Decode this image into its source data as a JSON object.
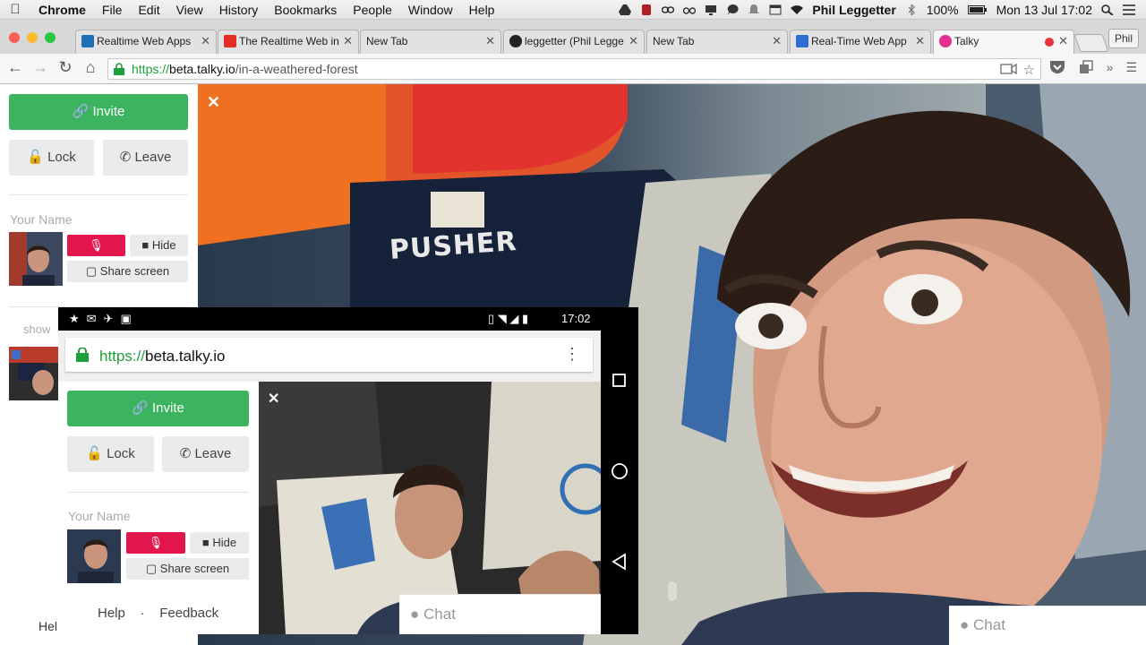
{
  "menubar": {
    "app": "Chrome",
    "items": [
      "File",
      "Edit",
      "View",
      "History",
      "Bookmarks",
      "People",
      "Window",
      "Help"
    ],
    "user": "Phil Leggetter",
    "battery": "100%",
    "datetime": "Mon 13 Jul  17:02"
  },
  "tabs": [
    {
      "title": "Realtime Web Apps",
      "favicon_color": "#1f6fb5"
    },
    {
      "title": "The Realtime Web in",
      "favicon_color": "#e52d27"
    },
    {
      "title": "New Tab",
      "favicon_color": ""
    },
    {
      "title": "leggetter (Phil Legge",
      "favicon_color": "#222222"
    },
    {
      "title": "New Tab",
      "favicon_color": ""
    },
    {
      "title": "Real-Time Web App",
      "favicon_color": "#2a6fd1"
    },
    {
      "title": "Talky",
      "favicon_color": "#e62f8e"
    }
  ],
  "profile_button": "Phil",
  "address": {
    "scheme": "https://",
    "host": "beta.talky.io",
    "path": "/in-a-weathered-forest"
  },
  "sidebar": {
    "invite": "Invite",
    "lock": "Lock",
    "leave": "Leave",
    "your_name_placeholder": "Your Name",
    "hide": "Hide",
    "share_screen": "Share screen",
    "show_label": "show",
    "help": "Hel"
  },
  "main_video": {
    "shirt_text": "PUSHER"
  },
  "chat_placeholder": "Chat",
  "phone": {
    "time": "17:02",
    "url_scheme": "https://",
    "url_host": "beta.talky.io",
    "invite": "Invite",
    "lock": "Lock",
    "leave": "Leave",
    "your_name_placeholder": "Your Name",
    "hide": "Hide",
    "share_screen": "Share screen",
    "help": "Help",
    "separator": "·",
    "feedback": "Feedback",
    "chat_placeholder": "Chat"
  },
  "colors": {
    "invite_green": "#3cb35e",
    "mute_red": "#e2164d",
    "url_green": "#1e9f3a"
  }
}
